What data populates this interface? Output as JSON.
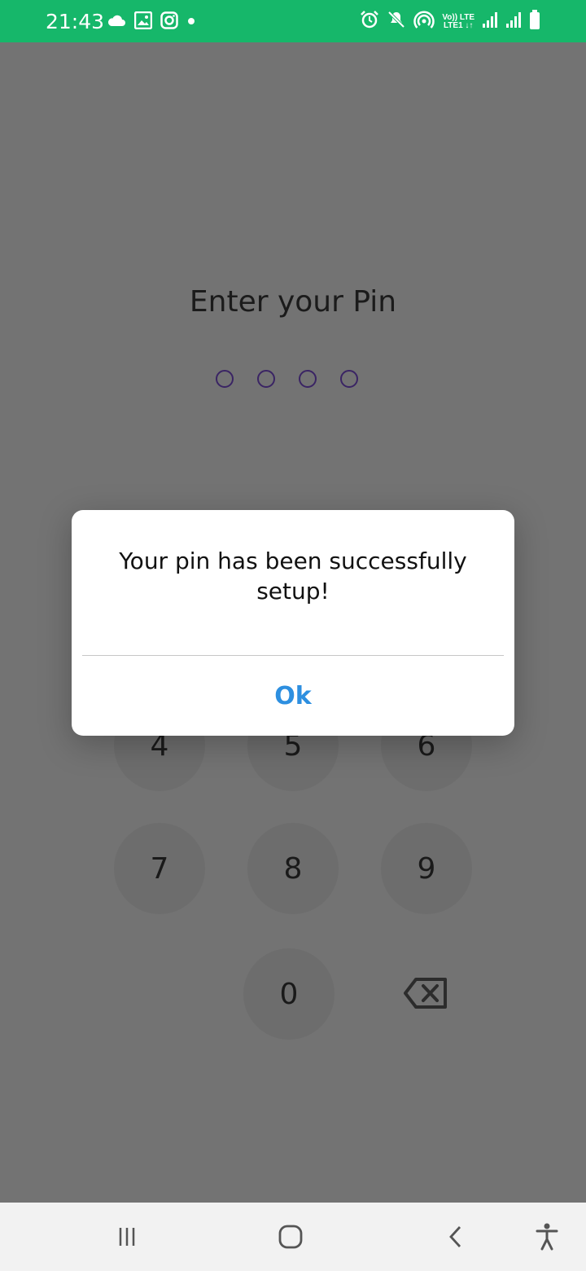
{
  "status_bar": {
    "time": "21:43",
    "left_icons": [
      "cloud-icon",
      "gallery-icon",
      "instagram-icon",
      "dot-icon"
    ],
    "right_icons": [
      "alarm-icon",
      "mute-icon",
      "hotspot-icon",
      "volte-icon",
      "signal-icon",
      "signal-icon",
      "battery-icon"
    ],
    "volte_top": "Vo)) LTE",
    "volte_bottom": "LTE1 ↓↑"
  },
  "pin_screen": {
    "title": "Enter your Pin",
    "pin_length": 4,
    "keys": [
      "4",
      "5",
      "6",
      "7",
      "8",
      "9",
      "0"
    ],
    "backspace_icon": "backspace-icon"
  },
  "dialog": {
    "message": "Your pin has been successfully setup!",
    "ok_label": "Ok"
  },
  "nav_bar": {
    "buttons": [
      "recent-apps-icon",
      "home-icon",
      "back-icon",
      "accessibility-icon"
    ]
  },
  "colors": {
    "status_bar": "#16b76a",
    "dim_background": "#737373",
    "dot_outline": "#3a2464",
    "ok_button": "#2d8fe0"
  }
}
